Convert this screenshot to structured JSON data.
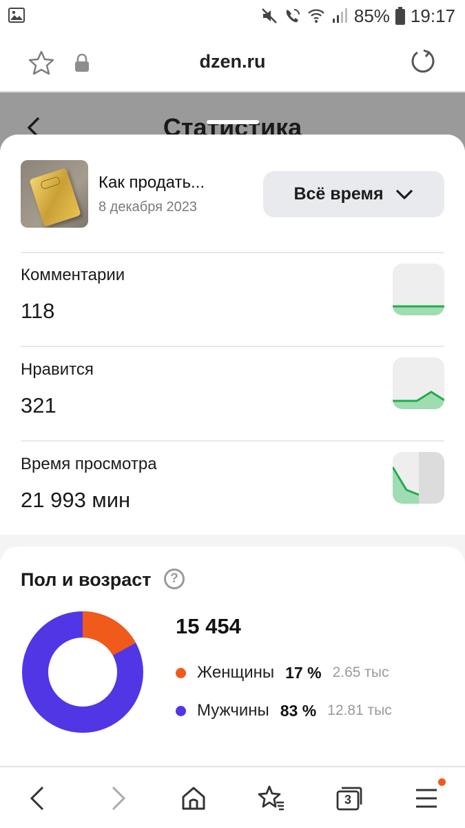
{
  "status_bar": {
    "battery": "85%",
    "time": "19:17"
  },
  "browser": {
    "url": "dzen.ru"
  },
  "page": {
    "title": "Статистика"
  },
  "publication": {
    "title": "Как продать...",
    "date": "8 декабря 2023",
    "period_label": "Всё время"
  },
  "metrics": [
    {
      "label": "Комментарии",
      "value": "118"
    },
    {
      "label": "Нравится",
      "value": "321"
    },
    {
      "label": "Время просмотра",
      "value": "21 993 мин"
    }
  ],
  "gender_age": {
    "title": "Пол и возраст",
    "help_glyph": "?",
    "total": "15 454",
    "segments": [
      {
        "name": "Женщины",
        "percent": "17 %",
        "absolute": "2.65 тыс",
        "color": "#f05a1a",
        "share": 0.17
      },
      {
        "name": "Мужчины",
        "percent": "83 %",
        "absolute": "12.81 тыс",
        "color": "#5136e6",
        "share": 0.83
      }
    ]
  },
  "colors": {
    "spark_line": "#1fae4b",
    "spark_fill": "#9fdcb2"
  },
  "bottom_nav": {
    "tabs_count": "3"
  },
  "icons": [
    "gallery-icon",
    "mute-icon",
    "wifi-call-icon",
    "wifi-icon",
    "signal-icon",
    "battery-icon",
    "star-icon",
    "lock-icon",
    "reload-icon",
    "back-icon",
    "chevron-down-icon",
    "help-icon",
    "nav-back-icon",
    "nav-forward-icon",
    "home-icon",
    "bookmarks-icon",
    "tabs-icon",
    "menu-icon"
  ]
}
